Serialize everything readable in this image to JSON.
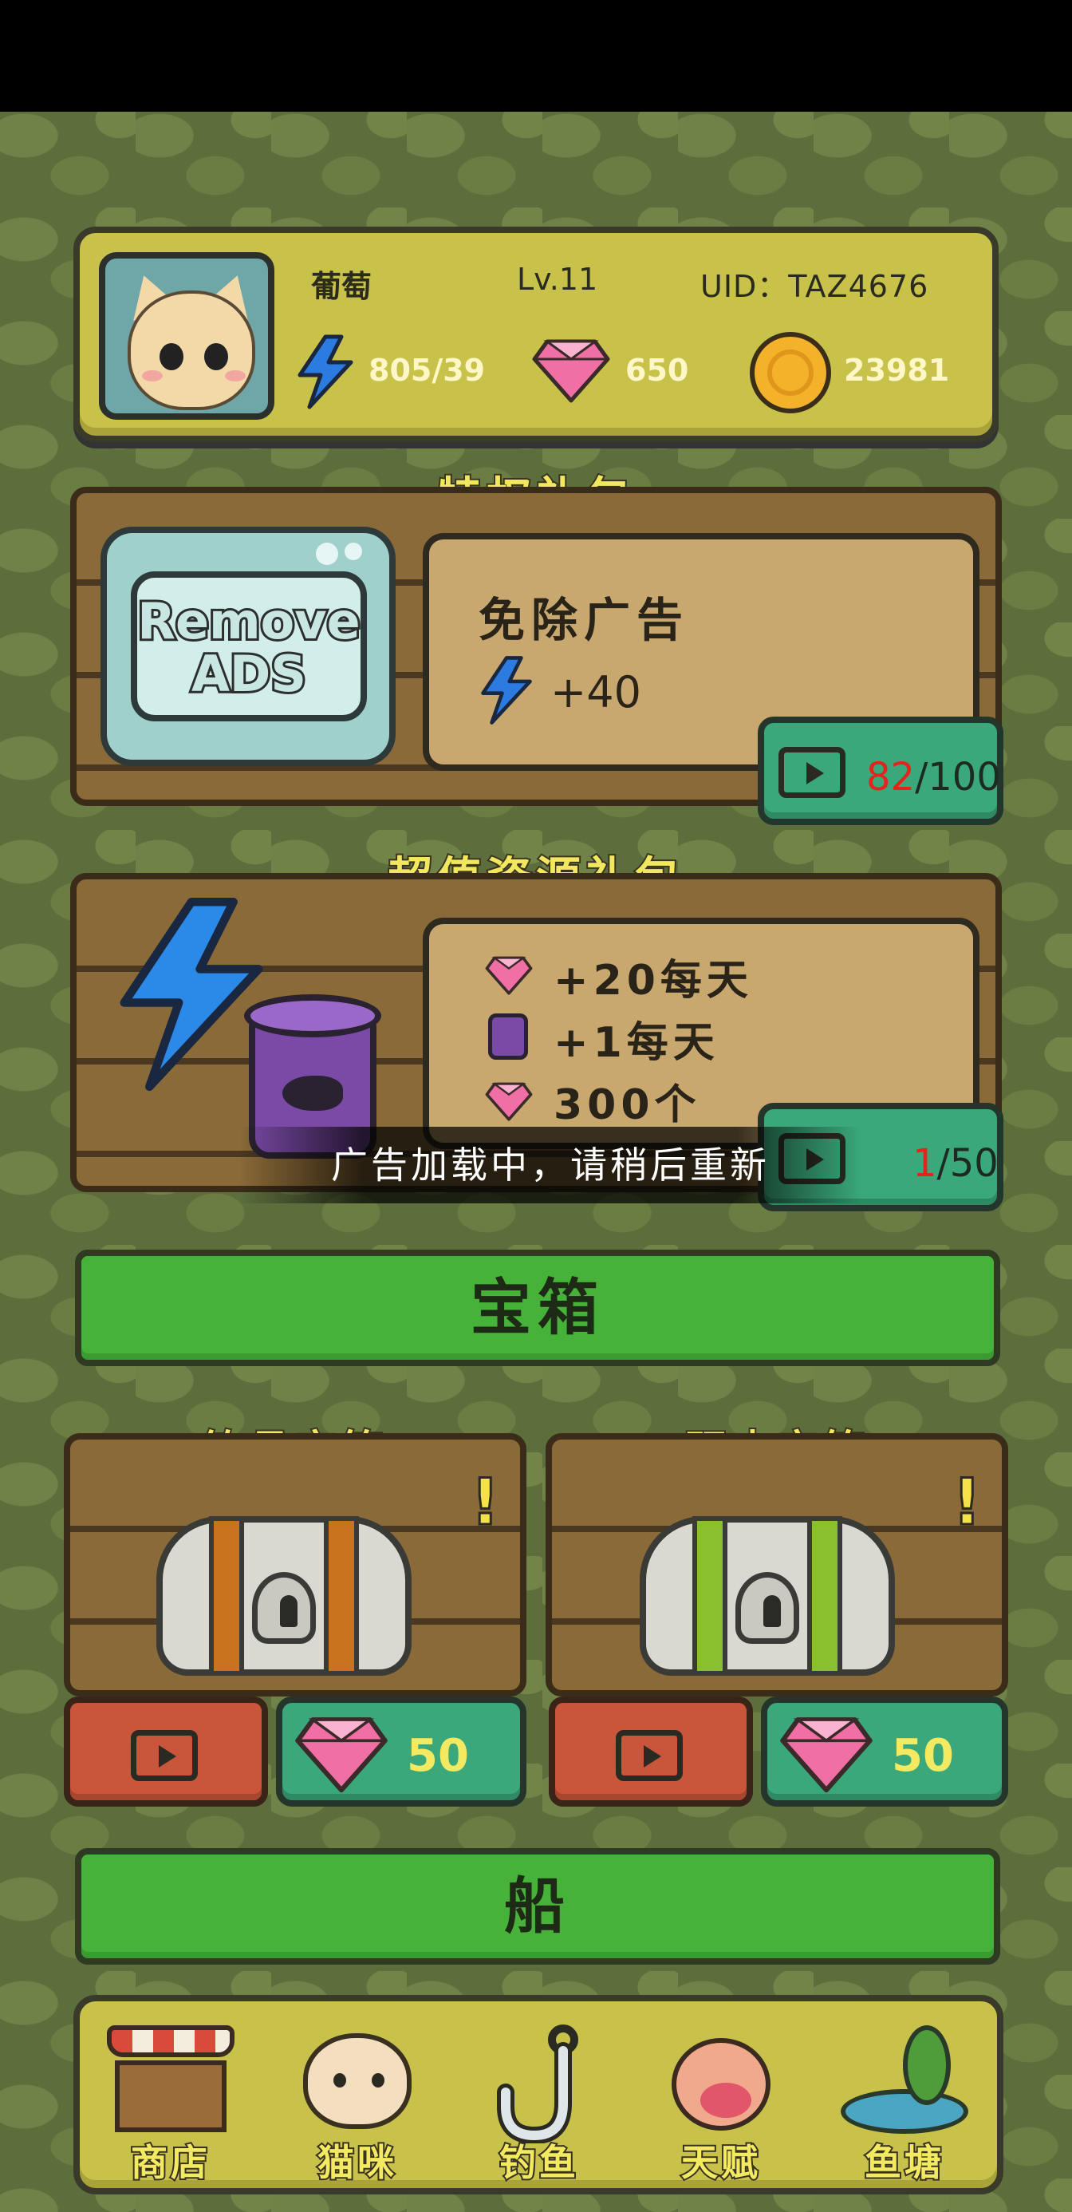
{
  "profile": {
    "name": "葡萄",
    "level": "Lv.11",
    "uid": "UID：TAZ4676",
    "energy": "805/39",
    "gems": "650",
    "coins": "23981"
  },
  "privilege_pack": {
    "title": "特权礼包",
    "tv_text_line1": "Remove",
    "tv_text_line2": "ADS",
    "name": "免除广告",
    "reward": "+40",
    "progress_current": "82",
    "progress_total": "/100"
  },
  "value_pack": {
    "title": "超值资源礼包",
    "rewards": [
      "+20每天",
      "+1每天",
      "300个"
    ],
    "progress_current": "1",
    "progress_total": "/50"
  },
  "toast": "广告加载中，请稍后重新",
  "chest_section": {
    "header": "宝箱",
    "chests": [
      {
        "title": "钓具宝箱",
        "price": "50",
        "band_color": "#c8741e"
      },
      {
        "title": "顽皮宝箱",
        "price": "50",
        "band_color": "#8abf2e"
      }
    ]
  },
  "boat_section": {
    "header": "船"
  },
  "nav": {
    "items": [
      {
        "label": "商店",
        "icon": "shop-icon"
      },
      {
        "label": "猫咪",
        "icon": "cat-icon"
      },
      {
        "label": "钓鱼",
        "icon": "fishing-hook-icon"
      },
      {
        "label": "天赋",
        "icon": "paw-icon"
      },
      {
        "label": "鱼塘",
        "icon": "pond-icon"
      }
    ]
  },
  "colors": {
    "progress_highlight": "#e3231c",
    "title_yellow": "#f2e860",
    "teal": "#3aa87a",
    "green_bar": "#47b23a"
  }
}
